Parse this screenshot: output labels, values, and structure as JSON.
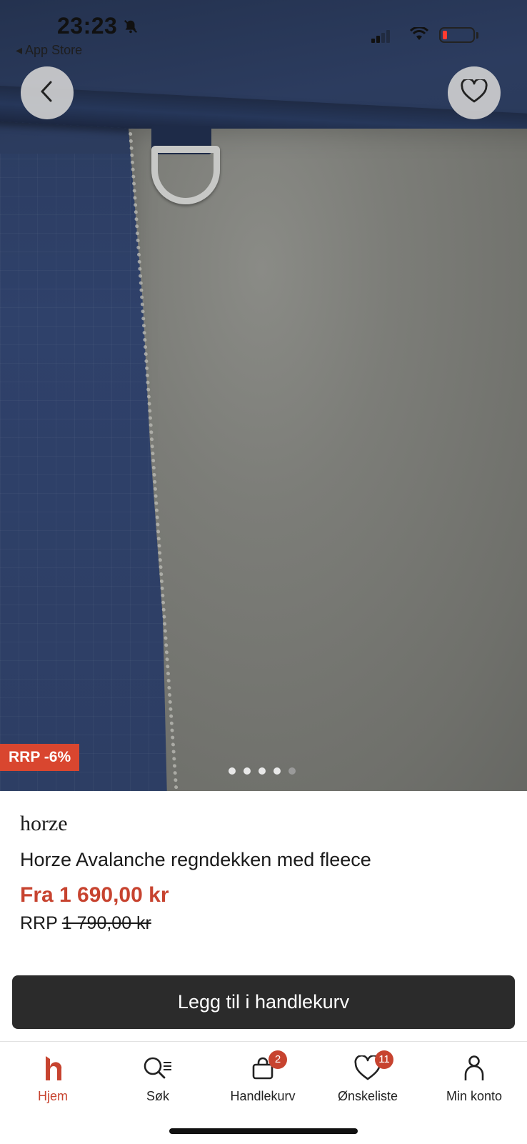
{
  "status_bar": {
    "time": "23:23",
    "back_app": "◂ App Store",
    "battery_color": "#ff3b30"
  },
  "hero": {
    "badge": "RRP -6%",
    "carousel_total": 5,
    "carousel_active": 4
  },
  "product": {
    "brand": "horze",
    "title": "Horze Avalanche regndekken med fleece",
    "price": "Fra 1 690,00 kr",
    "rrp_label": "RRP",
    "rrp_price": "1 790,00 kr"
  },
  "actions": {
    "add_to_cart": "Legg til i handlekurv",
    "back_icon": "chevron-left-icon",
    "favorite_icon": "heart-icon"
  },
  "tabbar": {
    "home": "Hjem",
    "search": "Søk",
    "cart": "Handlekurv",
    "cart_count": "2",
    "wishlist": "Ønskeliste",
    "wishlist_count": "11",
    "account": "Min konto"
  },
  "colors": {
    "accent": "#c7432f",
    "badge": "#d9462f",
    "button": "#2b2b2b"
  }
}
